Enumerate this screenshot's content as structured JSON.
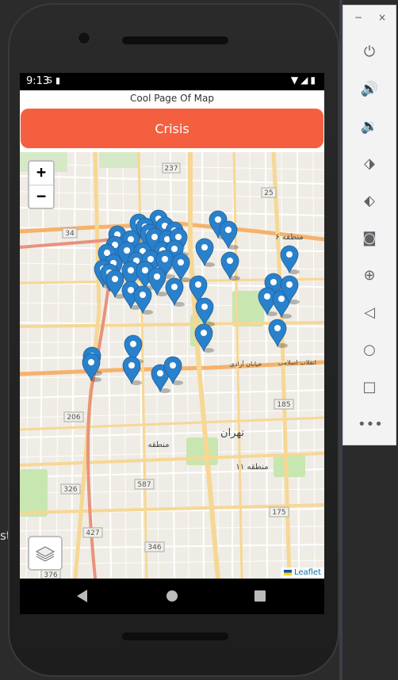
{
  "status_bar": {
    "time": "9:13",
    "left_icons": [
      "notification-icon",
      "sd-card-icon"
    ],
    "right_icons": [
      "wifi-icon",
      "signal-icon",
      "battery-icon"
    ]
  },
  "app": {
    "title": "Cool Page Of Map",
    "crisis_button_label": "Crisis",
    "crisis_button_color": "#f4603f"
  },
  "map": {
    "zoom_in_label": "+",
    "zoom_out_label": "−",
    "attribution": "Leaflet",
    "marker_color": "#2a81cb",
    "labels": {
      "tehran": "تهران",
      "region6": "منطقه ۶",
      "region11": "منطقه ۱۱",
      "region_w": "منطقه",
      "azadi": "خیابان آزادی",
      "enghelab": "انقلاب اسلامی",
      "r25": "25",
      "r34": "34",
      "r237": "237",
      "r185": "185",
      "r206": "206",
      "r587": "587",
      "r326": "326",
      "r175": "175",
      "r427": "427",
      "r346": "346",
      "r376": "376"
    }
  },
  "toolbar": {
    "minimize": "−",
    "close": "×",
    "buttons": [
      "power-icon",
      "volume-up-icon",
      "volume-down-icon",
      "rotate-left-icon",
      "rotate-right-icon",
      "camera-icon",
      "zoom-icon",
      "back-icon",
      "home-icon",
      "overview-icon",
      "more-icon"
    ]
  },
  "left_fragment": "st"
}
